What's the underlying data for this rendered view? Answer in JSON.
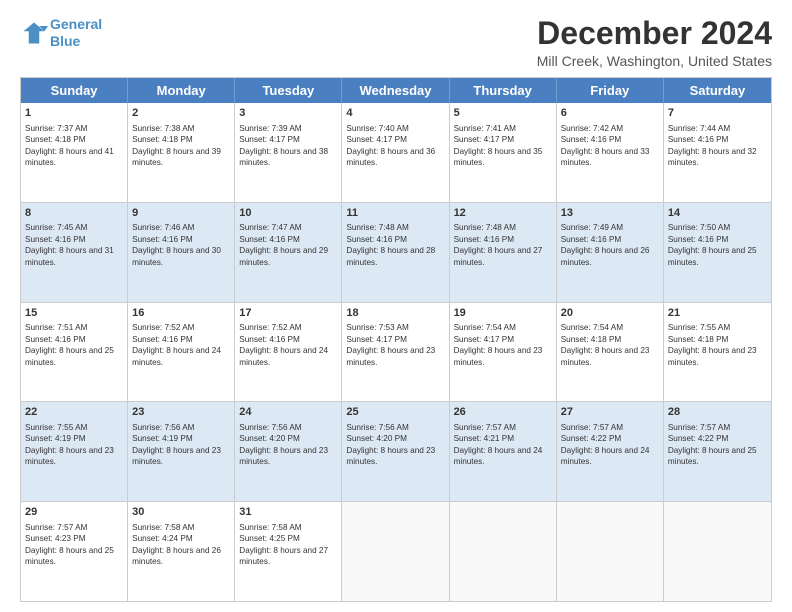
{
  "logo": {
    "line1": "General",
    "line2": "Blue"
  },
  "title": "December 2024",
  "location": "Mill Creek, Washington, United States",
  "days_of_week": [
    "Sunday",
    "Monday",
    "Tuesday",
    "Wednesday",
    "Thursday",
    "Friday",
    "Saturday"
  ],
  "weeks": [
    [
      {
        "day": "1",
        "sunrise": "7:37 AM",
        "sunset": "4:18 PM",
        "daylight": "8 hours and 41 minutes."
      },
      {
        "day": "2",
        "sunrise": "7:38 AM",
        "sunset": "4:18 PM",
        "daylight": "8 hours and 39 minutes."
      },
      {
        "day": "3",
        "sunrise": "7:39 AM",
        "sunset": "4:17 PM",
        "daylight": "8 hours and 38 minutes."
      },
      {
        "day": "4",
        "sunrise": "7:40 AM",
        "sunset": "4:17 PM",
        "daylight": "8 hours and 36 minutes."
      },
      {
        "day": "5",
        "sunrise": "7:41 AM",
        "sunset": "4:17 PM",
        "daylight": "8 hours and 35 minutes."
      },
      {
        "day": "6",
        "sunrise": "7:42 AM",
        "sunset": "4:16 PM",
        "daylight": "8 hours and 33 minutes."
      },
      {
        "day": "7",
        "sunrise": "7:44 AM",
        "sunset": "4:16 PM",
        "daylight": "8 hours and 32 minutes."
      }
    ],
    [
      {
        "day": "8",
        "sunrise": "7:45 AM",
        "sunset": "4:16 PM",
        "daylight": "8 hours and 31 minutes."
      },
      {
        "day": "9",
        "sunrise": "7:46 AM",
        "sunset": "4:16 PM",
        "daylight": "8 hours and 30 minutes."
      },
      {
        "day": "10",
        "sunrise": "7:47 AM",
        "sunset": "4:16 PM",
        "daylight": "8 hours and 29 minutes."
      },
      {
        "day": "11",
        "sunrise": "7:48 AM",
        "sunset": "4:16 PM",
        "daylight": "8 hours and 28 minutes."
      },
      {
        "day": "12",
        "sunrise": "7:48 AM",
        "sunset": "4:16 PM",
        "daylight": "8 hours and 27 minutes."
      },
      {
        "day": "13",
        "sunrise": "7:49 AM",
        "sunset": "4:16 PM",
        "daylight": "8 hours and 26 minutes."
      },
      {
        "day": "14",
        "sunrise": "7:50 AM",
        "sunset": "4:16 PM",
        "daylight": "8 hours and 25 minutes."
      }
    ],
    [
      {
        "day": "15",
        "sunrise": "7:51 AM",
        "sunset": "4:16 PM",
        "daylight": "8 hours and 25 minutes."
      },
      {
        "day": "16",
        "sunrise": "7:52 AM",
        "sunset": "4:16 PM",
        "daylight": "8 hours and 24 minutes."
      },
      {
        "day": "17",
        "sunrise": "7:52 AM",
        "sunset": "4:16 PM",
        "daylight": "8 hours and 24 minutes."
      },
      {
        "day": "18",
        "sunrise": "7:53 AM",
        "sunset": "4:17 PM",
        "daylight": "8 hours and 23 minutes."
      },
      {
        "day": "19",
        "sunrise": "7:54 AM",
        "sunset": "4:17 PM",
        "daylight": "8 hours and 23 minutes."
      },
      {
        "day": "20",
        "sunrise": "7:54 AM",
        "sunset": "4:18 PM",
        "daylight": "8 hours and 23 minutes."
      },
      {
        "day": "21",
        "sunrise": "7:55 AM",
        "sunset": "4:18 PM",
        "daylight": "8 hours and 23 minutes."
      }
    ],
    [
      {
        "day": "22",
        "sunrise": "7:55 AM",
        "sunset": "4:19 PM",
        "daylight": "8 hours and 23 minutes."
      },
      {
        "day": "23",
        "sunrise": "7:56 AM",
        "sunset": "4:19 PM",
        "daylight": "8 hours and 23 minutes."
      },
      {
        "day": "24",
        "sunrise": "7:56 AM",
        "sunset": "4:20 PM",
        "daylight": "8 hours and 23 minutes."
      },
      {
        "day": "25",
        "sunrise": "7:56 AM",
        "sunset": "4:20 PM",
        "daylight": "8 hours and 23 minutes."
      },
      {
        "day": "26",
        "sunrise": "7:57 AM",
        "sunset": "4:21 PM",
        "daylight": "8 hours and 24 minutes."
      },
      {
        "day": "27",
        "sunrise": "7:57 AM",
        "sunset": "4:22 PM",
        "daylight": "8 hours and 24 minutes."
      },
      {
        "day": "28",
        "sunrise": "7:57 AM",
        "sunset": "4:22 PM",
        "daylight": "8 hours and 25 minutes."
      }
    ],
    [
      {
        "day": "29",
        "sunrise": "7:57 AM",
        "sunset": "4:23 PM",
        "daylight": "8 hours and 25 minutes."
      },
      {
        "day": "30",
        "sunrise": "7:58 AM",
        "sunset": "4:24 PM",
        "daylight": "8 hours and 26 minutes."
      },
      {
        "day": "31",
        "sunrise": "7:58 AM",
        "sunset": "4:25 PM",
        "daylight": "8 hours and 27 minutes."
      },
      null,
      null,
      null,
      null
    ]
  ]
}
